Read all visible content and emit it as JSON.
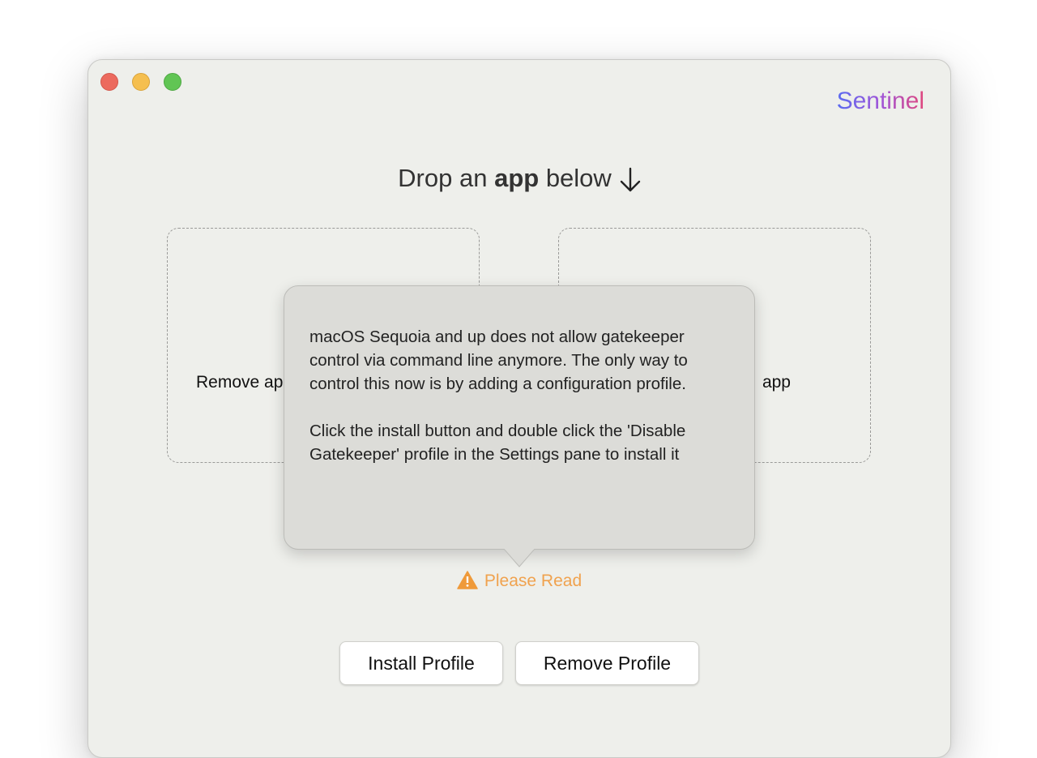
{
  "window": {
    "brand": "Sentinel"
  },
  "heading": {
    "prefix": "Drop an ",
    "bold": "app",
    "suffix": " below"
  },
  "zones": {
    "left_label": "Remove app",
    "right_label": "app"
  },
  "popover": {
    "paragraph1": "macOS Sequoia and up does not allow gatekeeper control via command line anymore. The only way to control this now is by adding a configuration profile.",
    "paragraph2": "Click the install button and double click the 'Disable Gatekeeper' profile in the Settings pane to install it"
  },
  "warning": {
    "label": "Please Read",
    "icon": "warning-triangle-icon",
    "color": "#f0a24e"
  },
  "buttons": {
    "install": "Install Profile",
    "remove": "Remove Profile"
  }
}
